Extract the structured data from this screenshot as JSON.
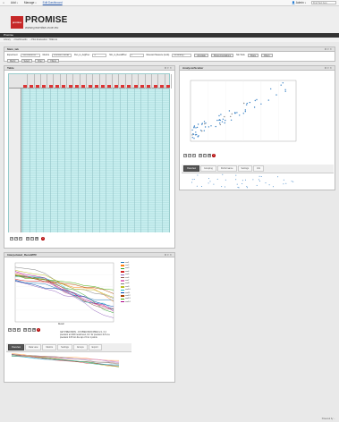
{
  "topbar": {
    "add_label": "Add",
    "manage_label": "Manage",
    "edit_label": "Edit Dashboard",
    "user_label": "Admin",
    "search_placeholder": "Find Text here"
  },
  "brand": {
    "logo": "promise",
    "name": "PROMISE",
    "url": "www.promise-noe.eu"
  },
  "project": {
    "title": "Promise"
  },
  "breadcrumb": [
    "Library",
    "Dashboards",
    "Pilot Evaluation: TREC-E"
  ],
  "main_panel": {
    "title": "Main_tab",
    "filters": [
      {
        "label": "Experiment",
        "value": "TrecVideo2011 ..."
      },
      {
        "label": "Metrics",
        "value": "Precision, Recall"
      },
      {
        "label": "Run_to_AvgPrec",
        "value": "4"
      },
      {
        "label": "Min_to_RecallPrec",
        "value": "5"
      },
      {
        "label": "Relevant Measure (tools)",
        "value": "Anmelding..."
      }
    ],
    "buttons": [
      "Annotate",
      "Show Annotations",
      "Tab Tools",
      "Share",
      "Filters",
      "Metric",
      "Select",
      "Filter",
      "Filters"
    ]
  },
  "table_panel": {
    "title": "Table"
  },
  "scatter_panel": {
    "title": "Analysis/Scatter",
    "tabs": [
      "Overview",
      "Grouping",
      "Performance",
      "Settings",
      "Info"
    ]
  },
  "line_panel": {
    "title": "Interpolated_Recall/PR",
    "x_label": "Recall",
    "legend": [
      "run1",
      "run2",
      "run3",
      "run4",
      "run5",
      "run6",
      "run7",
      "run8",
      "run9",
      "run10",
      "run11",
      "run12",
      "run13",
      "run14"
    ],
    "tabs": [
      "Overview",
      "Data view",
      "Metrics",
      "Settings",
      "Groups",
      "Export"
    ],
    "description": "GET PRECISION - 0.8 PRECISION PREC 2.1, 0.4 precision at 1000 recall level, 10 / for precision 0.8 to a precision 0.8 from the top of 0 to 1 points"
  },
  "footer": "Powered by ..."
}
